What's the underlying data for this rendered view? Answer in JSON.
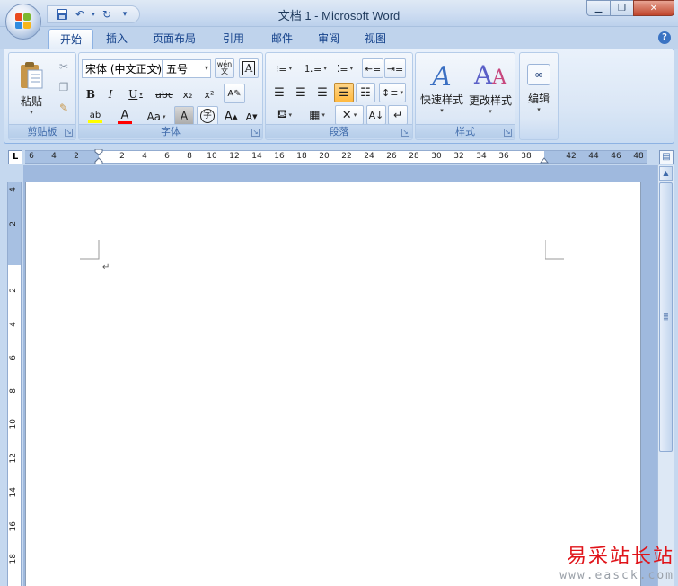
{
  "window": {
    "title": "文档 1 - Microsoft Word",
    "minimize_icon": "minimize-icon",
    "maximize_icon": "restore-icon",
    "close_label": "✕"
  },
  "quick_access": [
    "save-icon",
    "undo-icon",
    "redo-icon",
    "customize-icon"
  ],
  "tabs": [
    {
      "label": "开始",
      "active": true
    },
    {
      "label": "插入"
    },
    {
      "label": "页面布局"
    },
    {
      "label": "引用"
    },
    {
      "label": "邮件"
    },
    {
      "label": "审阅"
    },
    {
      "label": "视图"
    }
  ],
  "ribbon": {
    "clipboard": {
      "label": "剪贴板",
      "paste_label": "粘贴"
    },
    "font": {
      "label": "字体",
      "font_name": "宋体 (中文正文)",
      "font_size": "五号",
      "bold": "B",
      "italic": "I",
      "underline": "U",
      "strike": "abc",
      "subscript": "x₂",
      "superscript": "x²",
      "change_case": "Aa",
      "grow": "A",
      "shrink": "A",
      "char_shading": "A",
      "enclosed": "字",
      "phonetic": "wén 文",
      "char_border": "A",
      "highlight": "ab",
      "font_color": "A"
    },
    "paragraph": {
      "label": "段落"
    },
    "styles": {
      "label": "样式",
      "quick_styles": "快速样式",
      "change_styles": "更改样式"
    },
    "editing": {
      "label": "编辑"
    }
  },
  "ruler": {
    "h_ticks": [
      "6",
      "4",
      "2",
      "2",
      "4",
      "6",
      "8",
      "10",
      "12",
      "14",
      "16",
      "18",
      "20",
      "22",
      "24",
      "26",
      "28",
      "30",
      "32",
      "34",
      "36",
      "38",
      "42",
      "44",
      "46",
      "48"
    ],
    "v_ticks": [
      "4",
      "2",
      "2",
      "4",
      "6",
      "8",
      "10",
      "12",
      "14",
      "16",
      "18"
    ]
  },
  "colors": {
    "highlight": "#ffff00",
    "font_color": "#ff0000",
    "accent": "#15428b"
  },
  "watermark": {
    "title": "易采站长站",
    "url": "www.easck.com"
  }
}
